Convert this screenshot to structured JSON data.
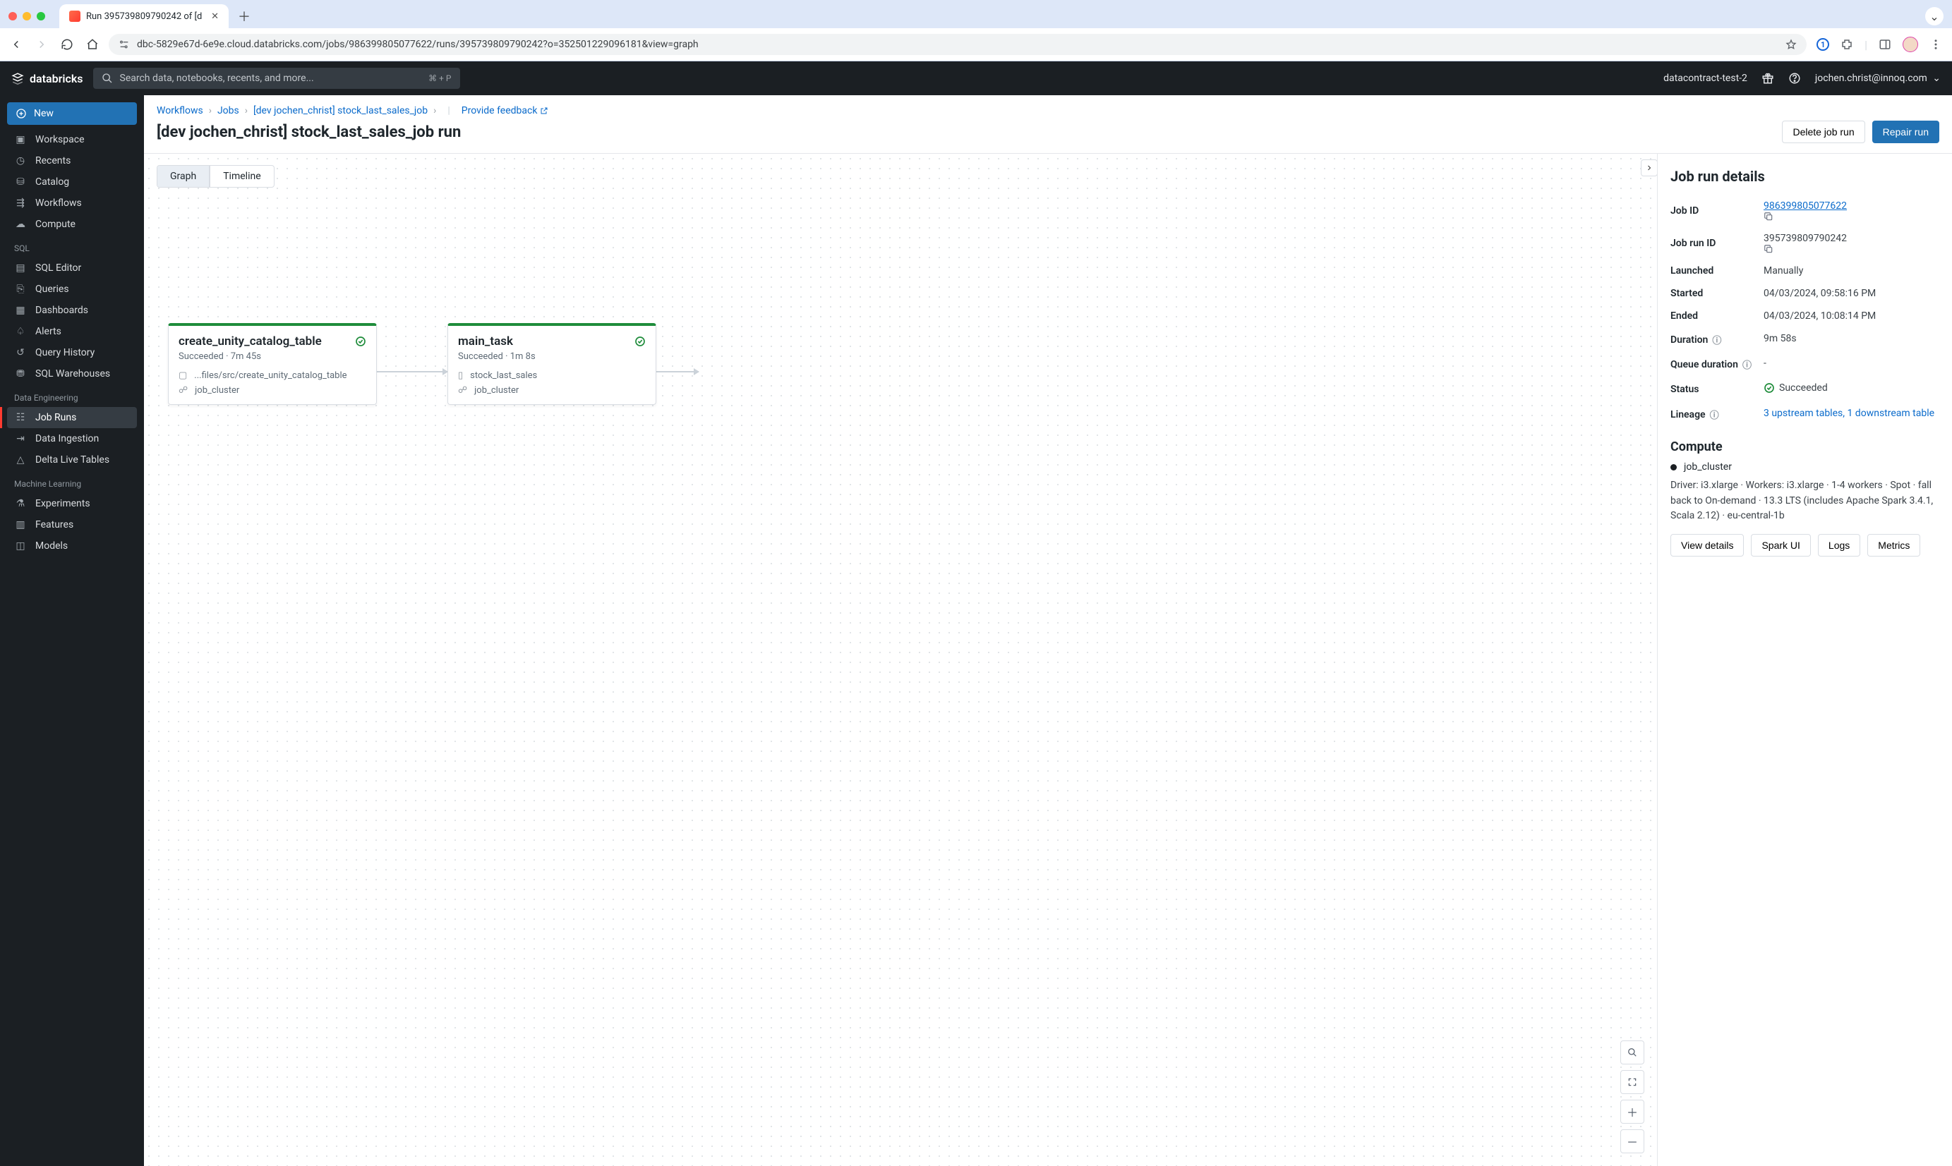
{
  "browser": {
    "tab_title": "Run 395739809790242 of [d",
    "url": "dbc-5829e67d-6e9e.cloud.databricks.com/jobs/986399805077622/runs/395739809790242?o=352501229096181&view=graph"
  },
  "topbar": {
    "brand": "databricks",
    "search_placeholder": "Search data, notebooks, recents, and more...",
    "search_kbd": "⌘ + P",
    "workspace_name": "datacontract-test-2",
    "user_email": "jochen.christ@innoq.com"
  },
  "sidebar": {
    "new_label": "New",
    "core": [
      "Workspace",
      "Recents",
      "Catalog",
      "Workflows",
      "Compute"
    ],
    "sql_label": "SQL",
    "sql": [
      "SQL Editor",
      "Queries",
      "Dashboards",
      "Alerts",
      "Query History",
      "SQL Warehouses"
    ],
    "data_eng_label": "Data Engineering",
    "data_eng": [
      "Job Runs",
      "Data Ingestion",
      "Delta Live Tables"
    ],
    "ml_label": "Machine Learning",
    "ml": [
      "Experiments",
      "Features",
      "Models"
    ]
  },
  "breadcrumbs": {
    "workflows": "Workflows",
    "jobs": "Jobs",
    "job_name": "[dev jochen_christ] stock_last_sales_job",
    "feedback": "Provide feedback"
  },
  "page": {
    "title": "[dev jochen_christ] stock_last_sales_job run",
    "delete_btn": "Delete job run",
    "repair_btn": "Repair run",
    "tabs": {
      "graph": "Graph",
      "timeline": "Timeline"
    }
  },
  "tasks": {
    "t1": {
      "name": "create_unity_catalog_table",
      "status": "Succeeded",
      "duration": "7m 45s",
      "file": "...files/src/create_unity_catalog_table",
      "cluster": "job_cluster"
    },
    "t2": {
      "name": "main_task",
      "status": "Succeeded",
      "duration": "1m 8s",
      "file": "stock_last_sales",
      "cluster": "job_cluster"
    }
  },
  "details": {
    "heading": "Job run details",
    "labels": {
      "job_id": "Job ID",
      "job_run_id": "Job run ID",
      "launched": "Launched",
      "started": "Started",
      "ended": "Ended",
      "duration": "Duration",
      "queue": "Queue duration",
      "status": "Status",
      "lineage": "Lineage"
    },
    "values": {
      "job_id": "986399805077622",
      "job_run_id": "395739809790242",
      "launched": "Manually",
      "started": "04/03/2024, 09:58:16 PM",
      "ended": "04/03/2024, 10:08:14 PM",
      "duration": "9m 58s",
      "queue": "-",
      "status": "Succeeded",
      "lineage": "3 upstream tables, 1 downstream table"
    },
    "compute_heading": "Compute",
    "compute": {
      "cluster": "job_cluster",
      "desc": "Driver: i3.xlarge · Workers: i3.xlarge · 1-4 workers · Spot · fall back to On-demand · 13.3 LTS (includes Apache Spark 3.4.1, Scala 2.12) · eu-central-1b",
      "buttons": {
        "view": "View details",
        "spark": "Spark UI",
        "logs": "Logs",
        "metrics": "Metrics"
      }
    }
  }
}
